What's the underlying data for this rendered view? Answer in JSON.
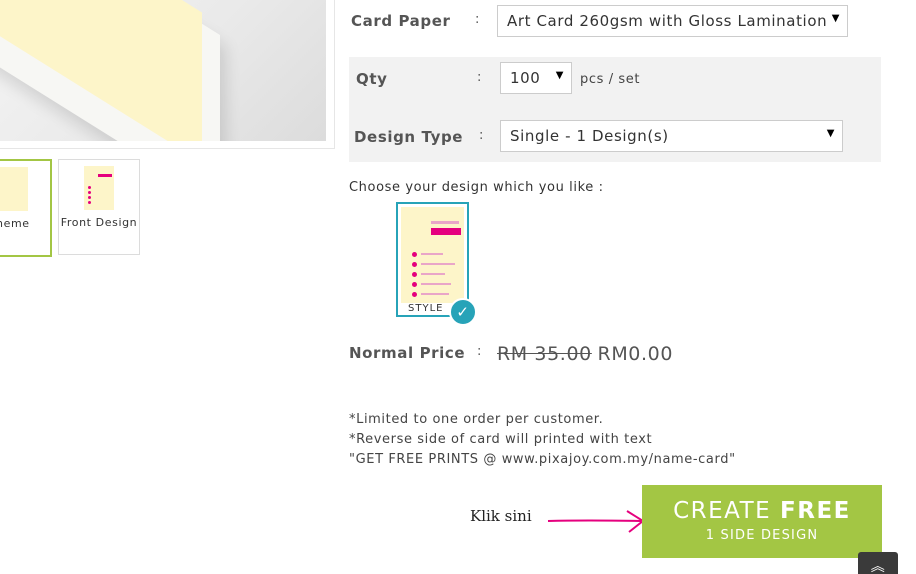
{
  "thumbnails": [
    {
      "label": "heme",
      "active": true
    },
    {
      "label": "Front Design",
      "active": false
    }
  ],
  "form": {
    "card_paper": {
      "label": "Card Paper",
      "colon": ":",
      "value": "Art Card 260gsm with Gloss Lamination"
    },
    "qty": {
      "label": "Qty",
      "colon": ":",
      "value": "100",
      "unit": "pcs / set"
    },
    "design_type": {
      "label": "Design Type",
      "colon": ":",
      "value": "Single - 1 Design(s)"
    }
  },
  "design_chooser": {
    "prompt": "Choose your design which you like :",
    "styles": [
      {
        "label": "STYLE",
        "selected": true
      }
    ]
  },
  "price": {
    "label": "Normal Price",
    "colon": ":",
    "original": "RM 35.00",
    "current": "RM0.00"
  },
  "notes": [
    "*Limited to one order per customer.",
    "*Reverse side of card will printed with text",
    "\"GET FREE PRINTS @ www.pixajoy.com.my/name-card\""
  ],
  "cta": {
    "hint": "Klik sini",
    "line1_prefix": "CREATE",
    "line1_emph": "FREE",
    "line2": "1 SIDE DESIGN"
  },
  "icons": {
    "arrow": "hand-drawn-arrow-icon",
    "check": "check-icon",
    "scroll": "double-chevron-up-icon"
  },
  "colors": {
    "accent_green": "#a3c644",
    "teal": "#27a3b8",
    "arrow_pink": "#e5007e",
    "card_yellow": "#fdf5c9"
  }
}
